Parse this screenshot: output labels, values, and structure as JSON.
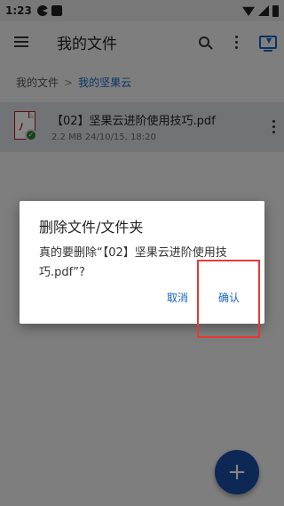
{
  "status_bar": {
    "time": "1:23"
  },
  "toolbar": {
    "title": "我的文件",
    "icons": [
      "menu-icon",
      "search-icon",
      "more-icon",
      "monitor-download-icon"
    ]
  },
  "breadcrumb": {
    "root": "我的文件",
    "separator": ">",
    "current": "我的坚果云"
  },
  "file": {
    "name": "【02】坚果云进阶使用技巧.pdf",
    "meta": "2.2 MB 24/10/15, 18:20",
    "icon": "pdf-icon",
    "badge": "check-icon"
  },
  "dialog": {
    "title": "删除文件/文件夹",
    "message": "真的要删除“【02】坚果云进阶使用技巧.pdf”?",
    "cancel_label": "取消",
    "confirm_label": "确认"
  },
  "fab": {
    "label": "+"
  },
  "colors": {
    "accent": "#1565c0",
    "fab": "#1a4ea3",
    "annotation": "#e53935"
  }
}
